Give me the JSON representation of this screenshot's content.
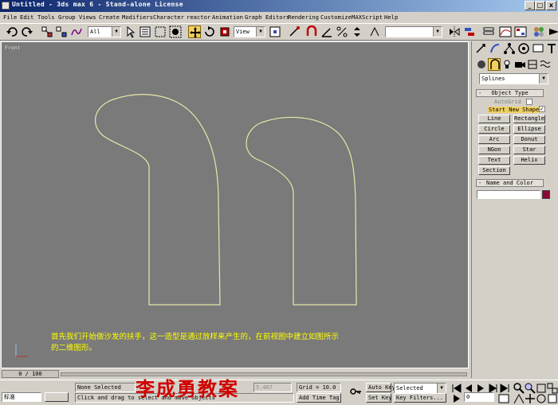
{
  "window": {
    "title": "Untitled - 3ds max 6 - Stand-alone License",
    "buttons": {
      "minimize": "_",
      "maximize": "□",
      "close": "x"
    }
  },
  "menubar": {
    "items": [
      "File",
      "Edit",
      "Tools",
      "Group",
      "Views",
      "Create",
      "Modifiers",
      "Character",
      "reactor",
      "Animation",
      "Graph Editors",
      "Rendering",
      "Customize",
      "MAXScript",
      "Help"
    ]
  },
  "toolbar": {
    "selection_filter": "All",
    "reference_coord": "View"
  },
  "viewport": {
    "label": "Front",
    "caption_line1": "首先我们开始做沙发的扶手，这一造型是通过放样来产生的，在前视图中建立如图所示",
    "caption_line2": "的二维图形。",
    "shape_color": "#e8e8a8",
    "background": "#7a7a7a"
  },
  "command_panel": {
    "category": "Splines",
    "object_type": {
      "title": "Object Type",
      "autogrid": "AutoGrid",
      "start_new_shape": "Start New Shape",
      "buttons": [
        "Line",
        "Rectangle",
        "Circle",
        "Ellipse",
        "Arc",
        "Donut",
        "NGon",
        "Star",
        "Text",
        "Helix",
        "Section"
      ]
    },
    "name_color": {
      "title": "Name and Color",
      "name_value": "",
      "swatch": "#8b0a3a"
    }
  },
  "timeline": {
    "slider": "0 / 100"
  },
  "statusbar": {
    "lang": "标准",
    "selection": "None Selected",
    "prompt": "Click and drag to select and move objects",
    "coord_y": "5.407",
    "grid": "Grid = 10.0",
    "add_time_tag": "Add Time Tag",
    "auto_key": "Auto Key",
    "set_key": "Set Key",
    "key_mode": "Selected",
    "key_filters": "Key Filters...",
    "frame": "0"
  },
  "watermark": "李成勇教案"
}
